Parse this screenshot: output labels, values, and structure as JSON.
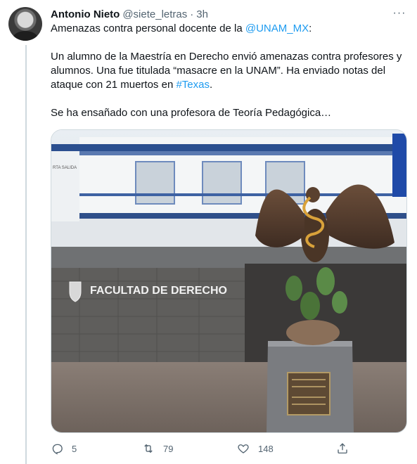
{
  "tweet": {
    "author_name": "Antonio Nieto",
    "handle": "@siete_letras",
    "separator": "·",
    "time": "3h",
    "more_label": "···",
    "text_line1_prefix": "Amenazas contra personal docente de la ",
    "mention": "@UNAM_MX",
    "text_line1_suffix": ":",
    "para2_prefix": "Un alumno de la Maestría en Derecho envió amenazas contra profesores y alumnos. Una fue titulada “masacre en la UNAM”. Ha enviado notas del ataque con 21 muertos en ",
    "hashtag": "#Texas",
    "para2_suffix": ".",
    "para3": "Se ha ensañado con una profesora de Teoría Pedagógica…"
  },
  "image": {
    "sign_text": "FACULTAD DE DERECHO",
    "small_sign": "RTA SALIDA"
  },
  "actions": {
    "reply_count": "5",
    "retweet_count": "79",
    "like_count": "148"
  },
  "icons": {
    "reply": "reply-icon",
    "retweet": "retweet-icon",
    "like": "heart-icon",
    "share": "share-icon",
    "more": "more-icon"
  },
  "colors": {
    "link": "#1d9bf0",
    "text": "#0f1419",
    "secondary": "#536471",
    "border": "#cfd9de"
  }
}
